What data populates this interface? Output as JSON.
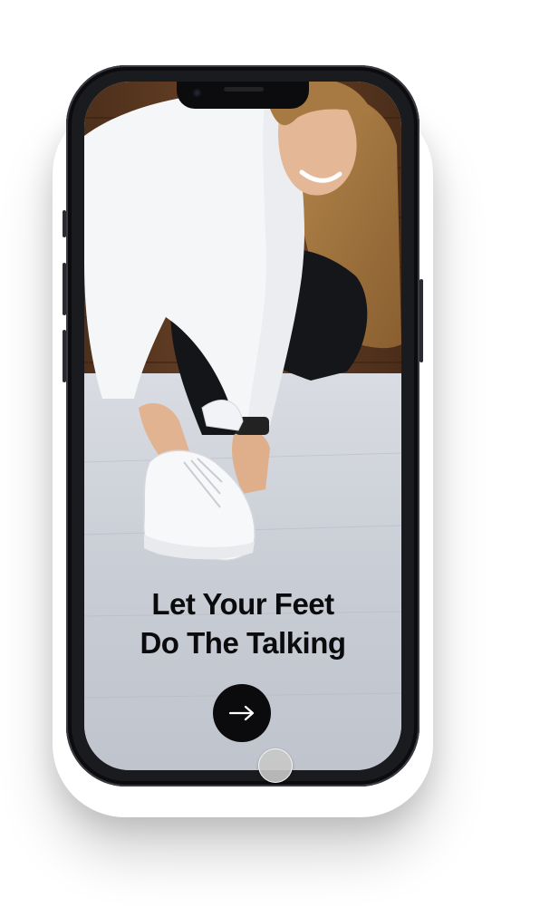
{
  "onboarding": {
    "headline_line1": "Let Your Feet",
    "headline_line2": "Do The Talking",
    "next_button_icon": "arrow-right-icon"
  },
  "colors": {
    "text": "#0b0b0d",
    "button": "#0b0b0d",
    "floor": "#c8ccd4",
    "wall": "#5e3c22"
  }
}
